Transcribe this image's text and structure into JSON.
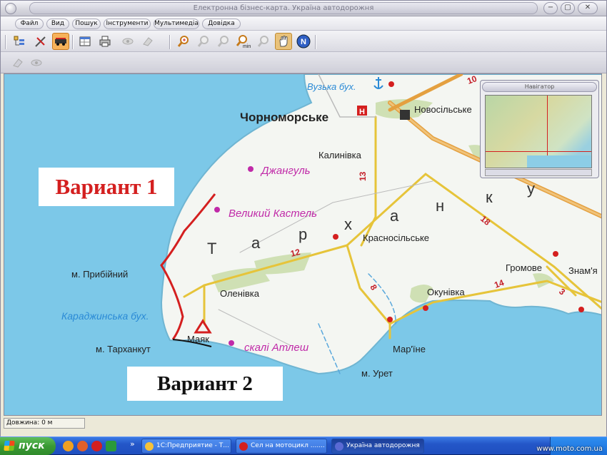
{
  "window": {
    "title": "Електронна бізнес-карта. Україна автодорожня",
    "controls": [
      "−",
      "▢",
      "✕"
    ]
  },
  "menu": [
    "Файл",
    "Вид",
    "Пошук",
    "Інструменти",
    "Мультимедіа",
    "Довідка"
  ],
  "toolbar": {
    "icons": [
      "layers-icon",
      "ruler-icon",
      "route-icon",
      "table-icon",
      "print-icon",
      "eye-icon",
      "eraser-icon",
      "zoom-in-icon",
      "zoom-out-icon",
      "zoom-area-icon",
      "zoom-min-icon",
      "zoom-max-icon",
      "hand-icon",
      "north-icon"
    ],
    "zoom_min_label": "min"
  },
  "map": {
    "labels": {
      "chornomorske": "Чорноморське",
      "vuzka": "Вузька бух.",
      "novosilske": "Новосільське",
      "kalynivka": "Калинівка",
      "dzhangul": "Джангуль",
      "velykyi_kastel": "Великий Кастель",
      "krasnosilske": "Красносільське",
      "prybiinyi": "м. Прибійний",
      "olenivka": "Оленівка",
      "karadzhynska": "Караджинська бух.",
      "mayak": "Маяк",
      "tarkhankut": "м. Тарханкут",
      "atlesh": "скалі Атлеш",
      "marine": "Мар'їне",
      "uret": "м. Урет",
      "okunivka": "Окунівка",
      "gromove": "Громове",
      "znamyanka": "Знам'я",
      "region_letters": [
        "Т",
        "а",
        "р",
        "х",
        "а",
        "н",
        "к",
        "у"
      ],
      "road_numbers": [
        "10",
        "13",
        "12",
        "18",
        "8",
        "14",
        "3"
      ]
    },
    "annotations": {
      "variant1": "Вариант 1",
      "variant2": "Вариант 2"
    },
    "colors": {
      "sea": "#7cc8e8",
      "land": "#f4f6f2",
      "road": "#e6c43a",
      "road_main": "#e4a040",
      "variant1": "#d41f1f",
      "variant2": "#111111"
    }
  },
  "minimap": {
    "title": "Навігатор"
  },
  "statusbar": {
    "length": "Довжина: 0 м"
  },
  "taskbar": {
    "start": "пуск",
    "tasks": [
      "1С:Предприятие - Т...",
      "Сел на мотоцикл .......",
      "Україна автодорожня"
    ]
  },
  "watermark": "www.moto.com.ua"
}
